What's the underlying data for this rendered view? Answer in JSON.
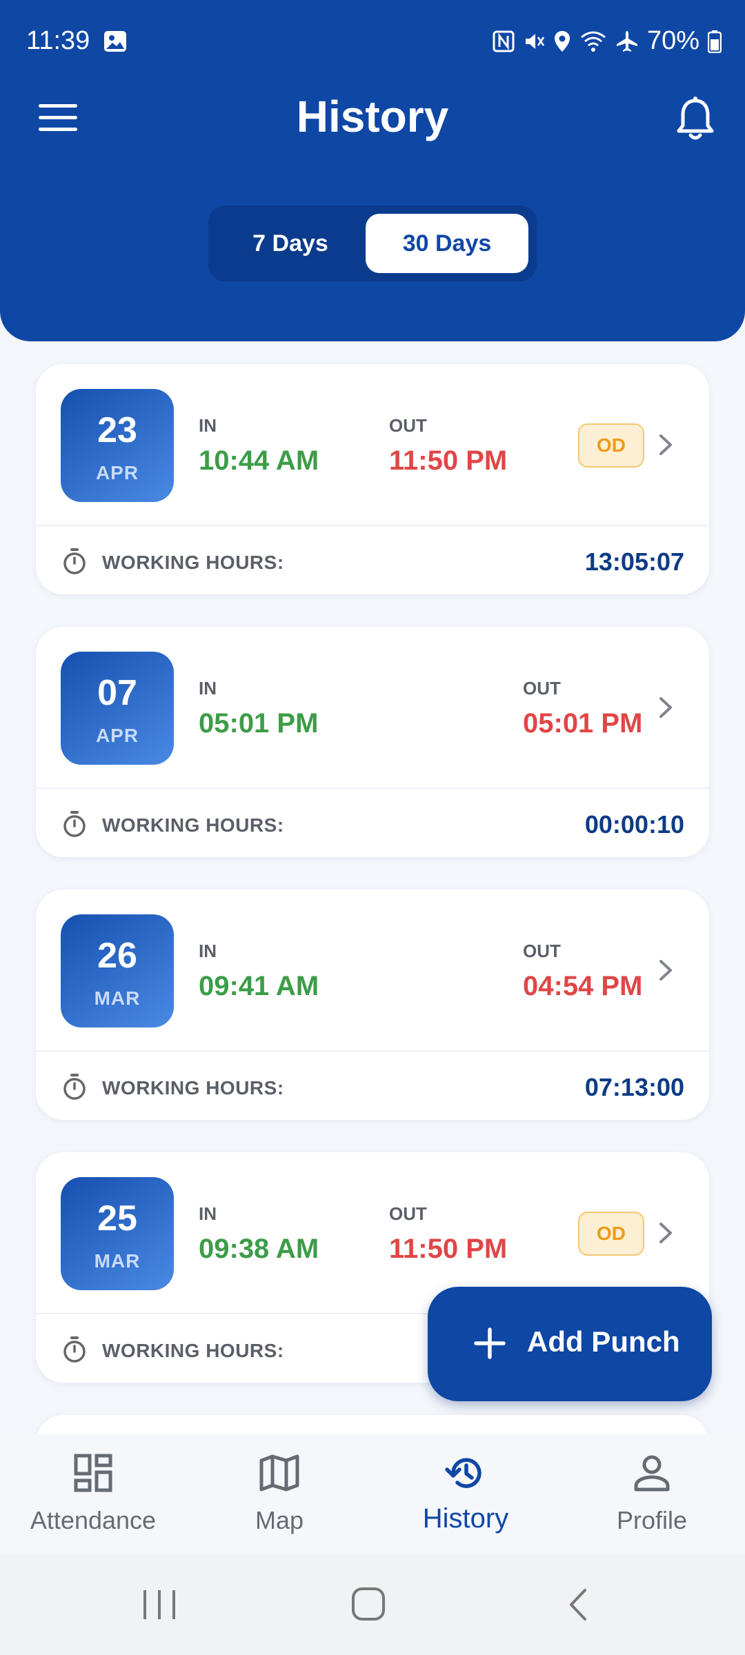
{
  "status_bar": {
    "time": "11:39",
    "battery": "70%"
  },
  "header": {
    "title": "History"
  },
  "filter": {
    "options": [
      "7 Days",
      "30 Days"
    ],
    "selected": "30 Days"
  },
  "records": [
    {
      "day": "23",
      "month": "APR",
      "in_label": "IN",
      "in_time": "10:44 AM",
      "out_label": "OUT",
      "out_time": "11:50 PM",
      "badge": "OD",
      "hours_label": "WORKING HOURS:",
      "hours": "13:05:07"
    },
    {
      "day": "07",
      "month": "APR",
      "in_label": "IN",
      "in_time": "05:01 PM",
      "out_label": "OUT",
      "out_time": "05:01 PM",
      "badge": "",
      "hours_label": "WORKING HOURS:",
      "hours": "00:00:10"
    },
    {
      "day": "26",
      "month": "MAR",
      "in_label": "IN",
      "in_time": "09:41 AM",
      "out_label": "OUT",
      "out_time": "04:54 PM",
      "badge": "",
      "hours_label": "WORKING HOURS:",
      "hours": "07:13:00"
    },
    {
      "day": "25",
      "month": "MAR",
      "in_label": "IN",
      "in_time": "09:38 AM",
      "out_label": "OUT",
      "out_time": "11:50 PM",
      "badge": "OD",
      "hours_label": "WORKING HOURS:",
      "hours": ""
    }
  ],
  "fab": {
    "label": "Add Punch"
  },
  "bottom_nav": [
    {
      "label": "Attendance",
      "icon": "dashboard-icon"
    },
    {
      "label": "Map",
      "icon": "map-icon"
    },
    {
      "label": "History",
      "icon": "history-icon",
      "active": true
    },
    {
      "label": "Profile",
      "icon": "person-icon"
    }
  ],
  "colors": {
    "primary": "#0f47a5",
    "in_time": "#3d9c48",
    "out_time": "#e04646",
    "badge": "#ef9a17"
  }
}
